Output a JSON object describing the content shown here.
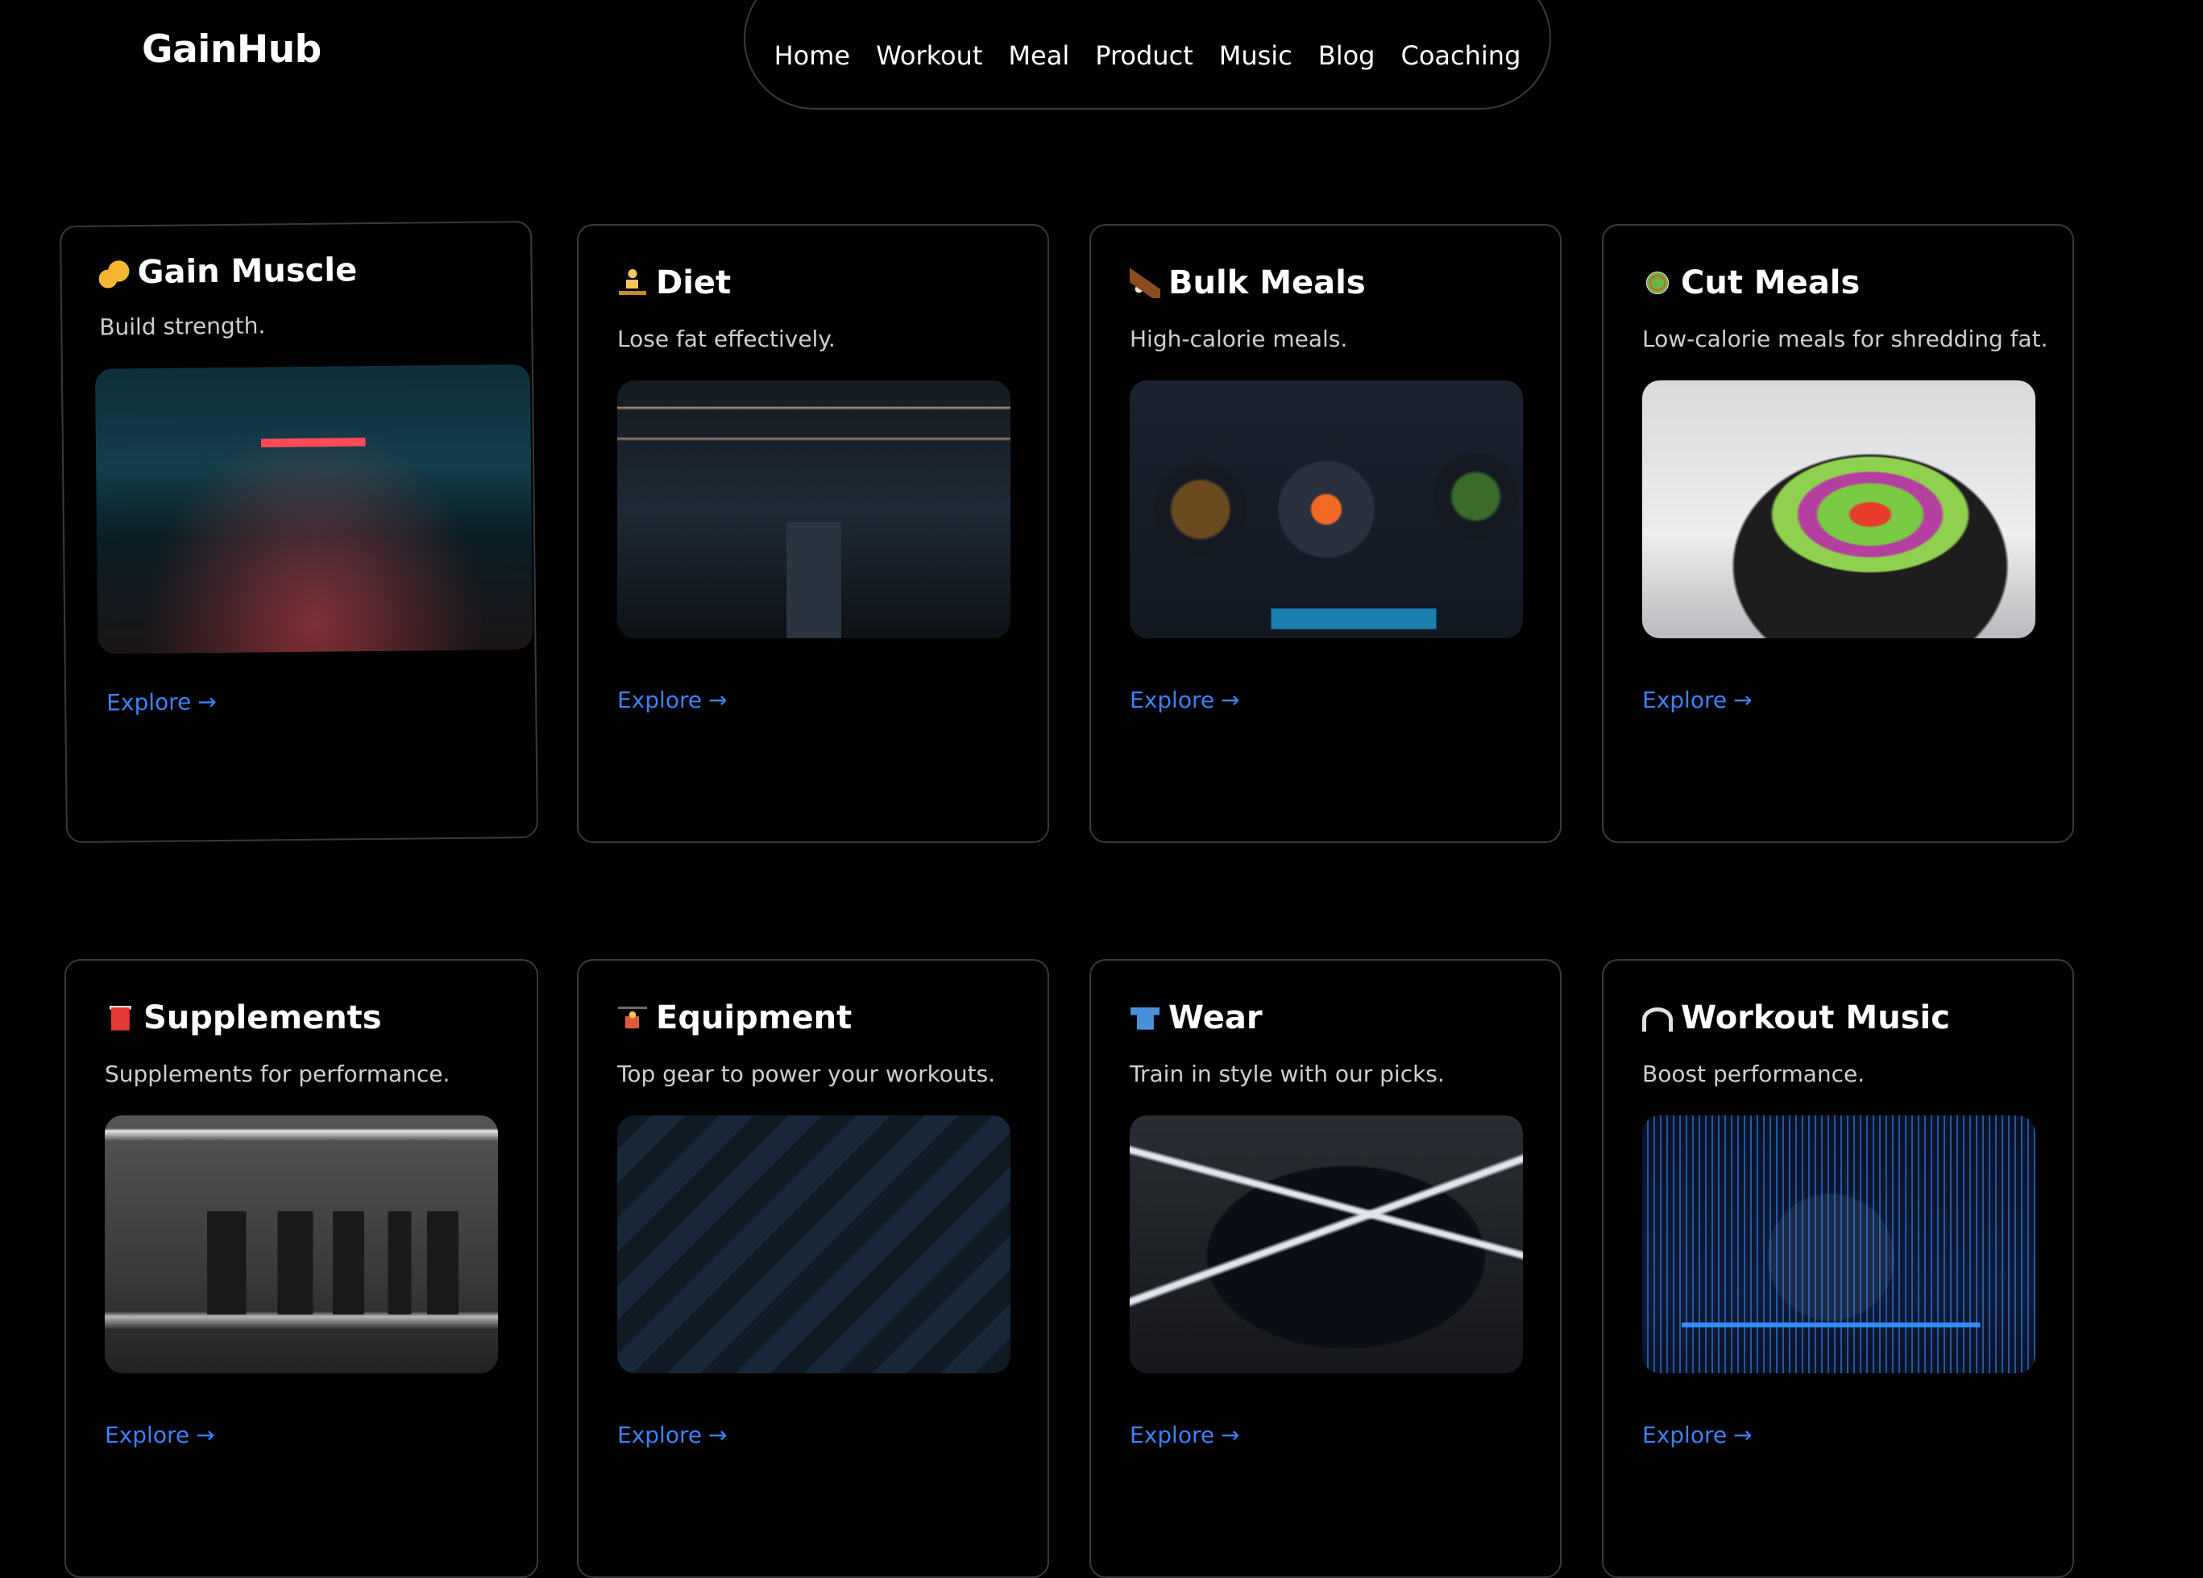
{
  "brand": {
    "name": "GainHub"
  },
  "nav": {
    "items": [
      "Home",
      "Workout",
      "Meal",
      "Product",
      "Music",
      "Blog",
      "Coaching"
    ]
  },
  "cards": [
    {
      "icon": "flexed-biceps-icon",
      "title": "Gain Muscle",
      "description": "Build strength.",
      "image": "dark-gym-neon-image",
      "link": "Explore",
      "arrow": "→"
    },
    {
      "icon": "meditation-icon",
      "title": "Diet",
      "description": "Lose fat effectively.",
      "image": "gym-corridor-image",
      "link": "Explore",
      "arrow": "→"
    },
    {
      "icon": "poultry-leg-icon",
      "title": "Bulk Meals",
      "description": "High-calorie meals.",
      "image": "meal-table-image",
      "link": "Explore",
      "arrow": "→"
    },
    {
      "icon": "salad-icon",
      "title": "Cut Meals",
      "description": "Low-calorie meals for shredding fat.",
      "image": "salad-bowl-image",
      "link": "Explore",
      "arrow": "→"
    },
    {
      "icon": "cup-icon",
      "title": "Supplements",
      "description": "Supplements for performance.",
      "image": "supplement-shelf-image",
      "link": "Explore",
      "arrow": "→"
    },
    {
      "icon": "weightlifter-icon",
      "title": "Equipment",
      "description": "Top gear to power your workouts.",
      "image": "gym-gear-image",
      "link": "Explore",
      "arrow": "→"
    },
    {
      "icon": "t-shirt-icon",
      "title": "Wear",
      "description": "Train in style with our picks.",
      "image": "sportswear-image",
      "link": "Explore",
      "arrow": "→"
    },
    {
      "icon": "headphones-icon",
      "title": "Workout Music",
      "description": "Boost performance.",
      "image": "headphones-image",
      "link": "Explore",
      "arrow": "→"
    }
  ],
  "colors": {
    "background": "#000000",
    "card_border": "#3a3a3a",
    "link": "#3b82f6",
    "text": "#ffffff",
    "muted_text": "#cfcfcf"
  }
}
